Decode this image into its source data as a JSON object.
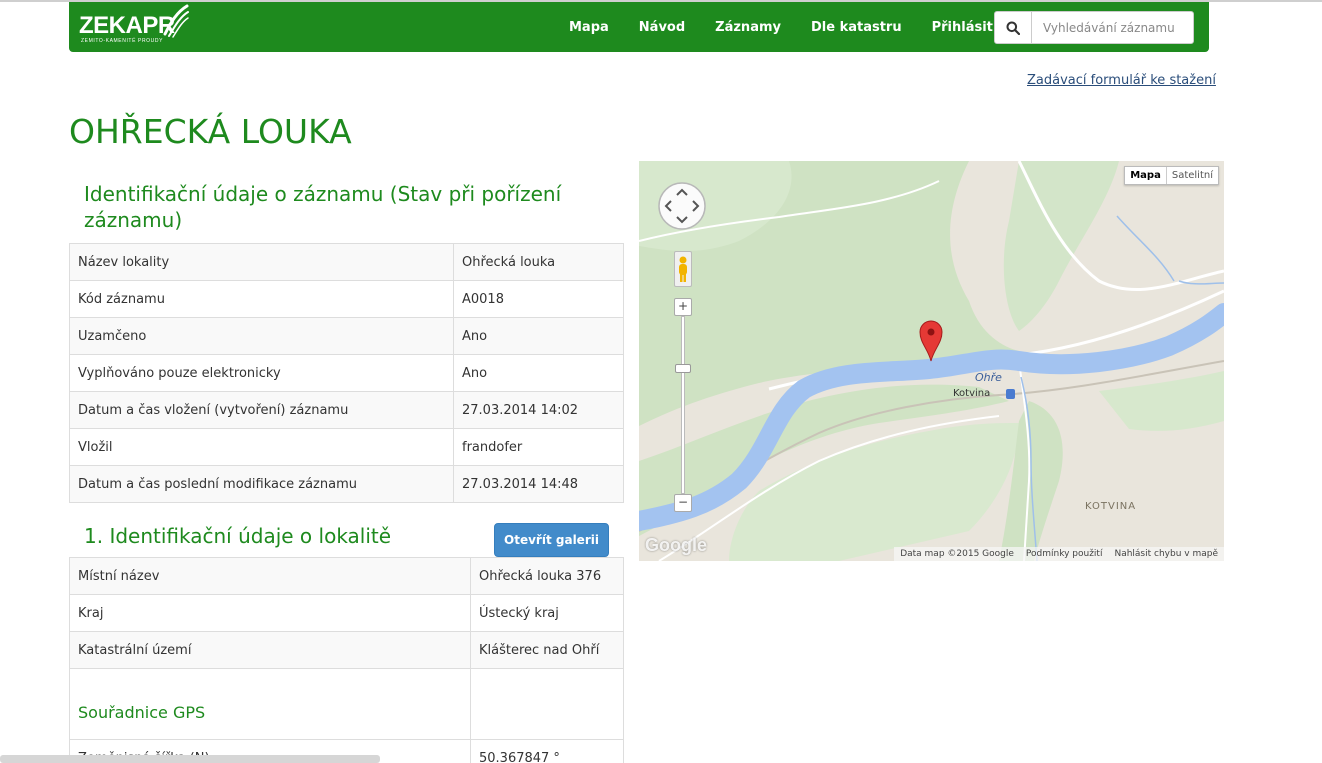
{
  "navbar": {
    "logo_text": "ZEKAPR",
    "logo_subtitle": "ZEMITO-KAMENITÉ PROUDY",
    "links": [
      "Mapa",
      "Návod",
      "Záznamy",
      "Dle katastru",
      "Přihlásit"
    ],
    "search_placeholder": "Vyhledávání záznamu",
    "search_icon": "search-icon",
    "color": "#1e8a1e"
  },
  "download_link": "Zadávací formulář ke stažení",
  "page_title": "OHŘECKÁ LOUKA",
  "section1": {
    "title": "Identifikační údaje o záznamu (Stav při pořízení záznamu)",
    "rows": [
      [
        "Název lokality",
        "Ohřecká louka"
      ],
      [
        "Kód záznamu",
        "A0018"
      ],
      [
        "Uzamčeno",
        "Ano"
      ],
      [
        "Vyplňováno pouze elektronicky",
        "Ano"
      ],
      [
        "Datum a čas vložení (vytvoření) záznamu",
        "27.03.2014 14:02"
      ],
      [
        "Vložil",
        "frandofer"
      ],
      [
        "Datum a čas poslední modifikace záznamu",
        "27.03.2014 14:48"
      ]
    ]
  },
  "section2": {
    "title": "1. Identifikační údaje o lokalitě",
    "gallery_button": "Otevřít galerii",
    "rows": [
      [
        "Místní název",
        "Ohřecká louka 376"
      ],
      [
        "Kraj",
        "Ústecký kraj"
      ],
      [
        "Katastrální území",
        "Klášterec nad Ohří"
      ]
    ],
    "gps_title": "Souřadnice GPS",
    "gps_rows": [
      [
        "Zeměpisná šířka (N)",
        "50.367847 °"
      ]
    ]
  },
  "map": {
    "type_buttons": [
      "Mapa",
      "Satelitní"
    ],
    "labels": {
      "river": "Ohře",
      "station": "Kotvina",
      "area": "KOTVINA"
    },
    "logo": "Google",
    "footer": [
      "Data map ©2015 Google",
      "Podmínky použití",
      "Nahlásit chybu v mapě"
    ],
    "zoom_in": "+",
    "zoom_out": "−",
    "marker_icon": "map-marker-icon"
  }
}
